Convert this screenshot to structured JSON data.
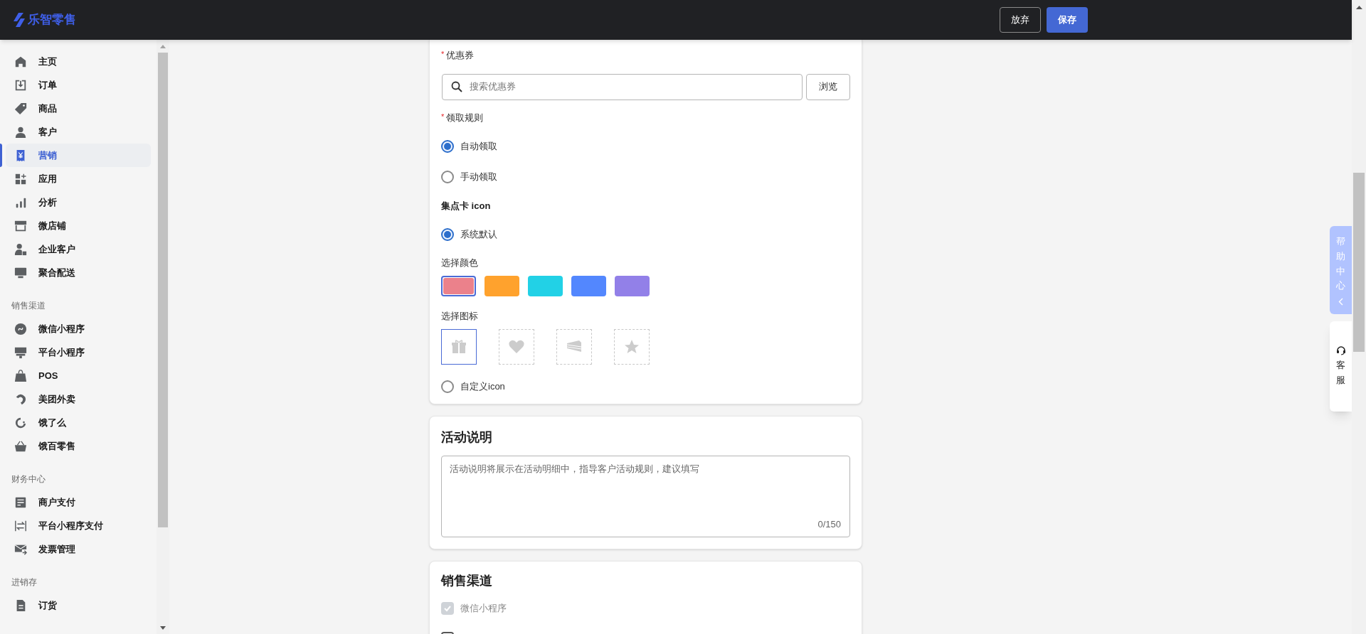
{
  "header": {
    "logo": "乐智零售",
    "buttons": [
      {
        "label": "放弃",
        "kind": "secondary"
      },
      {
        "label": "保存",
        "kind": "primary"
      }
    ]
  },
  "sidebar": {
    "groups": [
      {
        "items": [
          {
            "label": "主页",
            "selected": false
          },
          {
            "label": "订单",
            "selected": false
          },
          {
            "label": "商品",
            "selected": false
          },
          {
            "label": "客户",
            "selected": false
          },
          {
            "label": "营销",
            "selected": true
          },
          {
            "label": "应用",
            "selected": false
          },
          {
            "label": "分析",
            "selected": false
          },
          {
            "label": "微店铺",
            "selected": false
          },
          {
            "label": "企业客户",
            "selected": false
          },
          {
            "label": "聚合配送",
            "selected": false
          }
        ]
      },
      {
        "title": "销售渠道",
        "items": [
          {
            "label": "微信小程序",
            "selected": false
          },
          {
            "label": "平台小程序",
            "selected": false
          },
          {
            "label": "POS",
            "selected": false
          },
          {
            "label": "美团外卖",
            "selected": false
          },
          {
            "label": "饿了么",
            "selected": false
          },
          {
            "label": "饿百零售",
            "selected": false
          }
        ]
      },
      {
        "title": "财务中心",
        "items": [
          {
            "label": "商户支付",
            "selected": false
          },
          {
            "label": "平台小程序支付",
            "selected": false
          },
          {
            "label": "发票管理",
            "selected": false
          }
        ]
      },
      {
        "title": "进销存",
        "items": [
          {
            "label": "订货",
            "selected": false
          }
        ]
      }
    ]
  },
  "coupon_card": {
    "coupon": {
      "label": "优惠券",
      "required_mark": "*",
      "placeholder": "搜索优惠券",
      "browse_button": "浏览"
    },
    "claim_rule": {
      "label": "领取规则",
      "required_mark": "*",
      "options": [
        {
          "label": "自动领取",
          "selected": true
        },
        {
          "label": "手动领取",
          "selected": false
        }
      ]
    },
    "stamp_icon": {
      "label": "集点卡 icon",
      "default_option": {
        "label": "系统默认",
        "selected": true
      },
      "color_label": "选择颜色",
      "colors": [
        {
          "color": "#eb818b",
          "selected": true
        },
        {
          "color": "#ffa22d",
          "selected": false
        },
        {
          "color": "#22d1e6",
          "selected": false
        },
        {
          "color": "#5387fe",
          "selected": false
        },
        {
          "color": "#9280e8",
          "selected": false
        }
      ],
      "icon_label": "选择图标",
      "icons": [
        {
          "kind": "gift",
          "selected": true
        },
        {
          "kind": "heart",
          "selected": false
        },
        {
          "kind": "cake",
          "selected": false
        },
        {
          "kind": "star",
          "selected": false
        }
      ],
      "custom_option": {
        "label": "自定义icon",
        "selected": false
      }
    }
  },
  "description_card": {
    "title": "活动说明",
    "placeholder": "活动说明将展示在活动明细中，指导客户活动规则，建议填写",
    "counter": "0/150"
  },
  "channels_card": {
    "title": "销售渠道",
    "options": [
      {
        "label": "微信小程序",
        "checked": true,
        "disabled": true
      },
      {
        "checked": false,
        "disabled": false
      }
    ]
  },
  "help_tab": {
    "label": "帮助中心"
  },
  "service_tab": {
    "label": "客服"
  }
}
